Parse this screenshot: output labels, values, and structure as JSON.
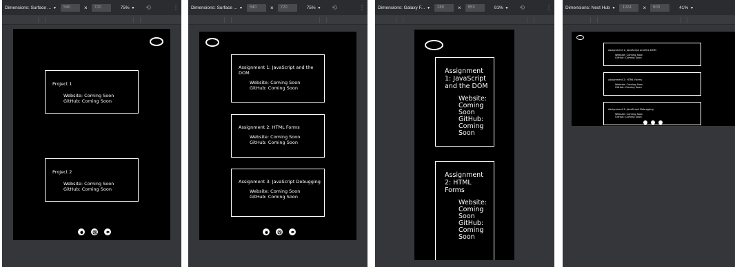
{
  "panels": [
    {
      "toolbar": {
        "dimensions": "Dimensions: Surface ...",
        "width": "540",
        "height": "720",
        "zoom": "75%"
      },
      "cards": [
        {
          "title": "Project 1",
          "website": "Website: Coming Soon",
          "github": "GitHub: Coming Soon"
        },
        {
          "title": "Project 2",
          "website": "Website: Coming Soon",
          "github": "GitHub: Coming Soon"
        }
      ]
    },
    {
      "toolbar": {
        "dimensions": "Dimensions: Surface ...",
        "width": "540",
        "height": "720",
        "zoom": "75%"
      },
      "cards": [
        {
          "title": "Assignment 1: JavaScript and the DOM",
          "website": "Website: Coming Soon",
          "github": "GitHub: Coming Soon"
        },
        {
          "title": "Assignment 2: HTML Forms",
          "website": "Website: Coming Soon",
          "github": "GitHub: Coming Soon"
        },
        {
          "title": "Assignment 3: JavaScript Debugging",
          "website": "Website: Coming Soon",
          "github": "GitHub: Coming Soon"
        }
      ]
    },
    {
      "toolbar": {
        "dimensions": "Dimensions: Galaxy F...",
        "width": "280",
        "height": "653",
        "zoom": "91%"
      },
      "cards": [
        {
          "title": "Assignment 1: JavaScript and the DOM",
          "website": "Website: Coming Soon",
          "github": "GitHub: Coming Soon"
        },
        {
          "title": "Assignment 2: HTML Forms",
          "website": "Website: Coming Soon",
          "github": "GitHub: Coming Soon"
        }
      ]
    },
    {
      "toolbar": {
        "dimensions": "Dimensions: Nest Hub",
        "width": "1024",
        "height": "600",
        "zoom": "41%"
      },
      "cards": [
        {
          "title": "Assignment 1: JavaScript and the DOM",
          "website": "Website: Coming Soon",
          "github": "GitHub: Coming Soon"
        },
        {
          "title": "Assignment 2: HTML Forms",
          "website": "Website: Coming Soon",
          "github": "GitHub: Coming Soon"
        },
        {
          "title": "Assignment 3: JavaScript Debugging",
          "website": "Website: Coming Soon",
          "github": "GitHub: Coming Soon"
        }
      ]
    }
  ],
  "icons": {
    "dropdown": "chevron-down-icon",
    "rotate": "rotate-icon",
    "more": "kebab-menu-icon",
    "logo": "oval-logo-icon",
    "footer": [
      "github-icon",
      "instagram-icon",
      "chat-icon"
    ]
  },
  "colors": {
    "devtools_bg": "#35363a",
    "toolbar_bg": "#2b2c30",
    "page_bg": "#000000",
    "text": "#ffffff"
  }
}
